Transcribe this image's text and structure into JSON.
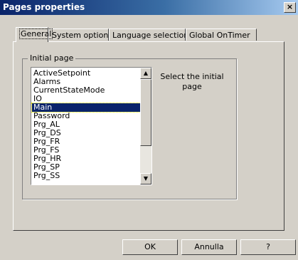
{
  "window": {
    "title": "Pages properties",
    "close_glyph": "×"
  },
  "tabs": [
    {
      "label": "General"
    },
    {
      "label": "System options"
    },
    {
      "label": "Language selection"
    },
    {
      "label": "Global OnTimer"
    }
  ],
  "group": {
    "label": "Initial page"
  },
  "list": {
    "items": [
      "ActiveSetpoint",
      "Alarms",
      "CurrentStateMode",
      "IO",
      "Main",
      "Password",
      "Prg_AL",
      "Prg_DS",
      "Prg_FR",
      "Prg_FS",
      "Prg_HR",
      "Prg_SP",
      "Prg_SS"
    ],
    "selected": "Main"
  },
  "hint": "Select the initial page",
  "buttons": {
    "ok": "OK",
    "cancel": "Annulla",
    "help": "?"
  },
  "icons": {
    "scroll_up": "▲",
    "scroll_down": "▼"
  }
}
